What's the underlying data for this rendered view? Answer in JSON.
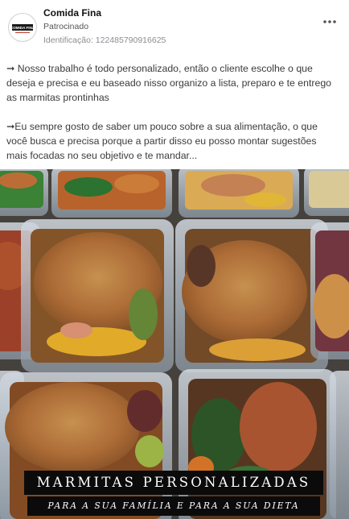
{
  "post": {
    "page_name": "Comida Fina",
    "sponsored_label": "Patrocinado",
    "identification": "Identificação: 122485790916625",
    "avatar_logo_text": "COMIDA FINA",
    "caption_paragraph_1": "➞ Nosso trabalho é todo personalizado, então o cliente escolhe o que deseja e precisa e eu baseado nisso organizo a lista, preparo e te entrego as marmitas prontinhas",
    "caption_paragraph_2": "➞Eu sempre gosto de saber um pouco sobre a sua alimentação, o que você busca e precisa porque a partir disso eu posso montar sugestões mais focadas no seu objetivo e te mandar..."
  },
  "image": {
    "banner_title": "MARMITAS PERSONALIZADAS",
    "banner_subtitle": "PARA A SUA FAMÍLIA E PARA A SUA DIETA"
  },
  "icons": {
    "more": "more-options-icon"
  },
  "colors": {
    "banner_background": "#0b0b0b",
    "banner_text": "#ffffff"
  }
}
